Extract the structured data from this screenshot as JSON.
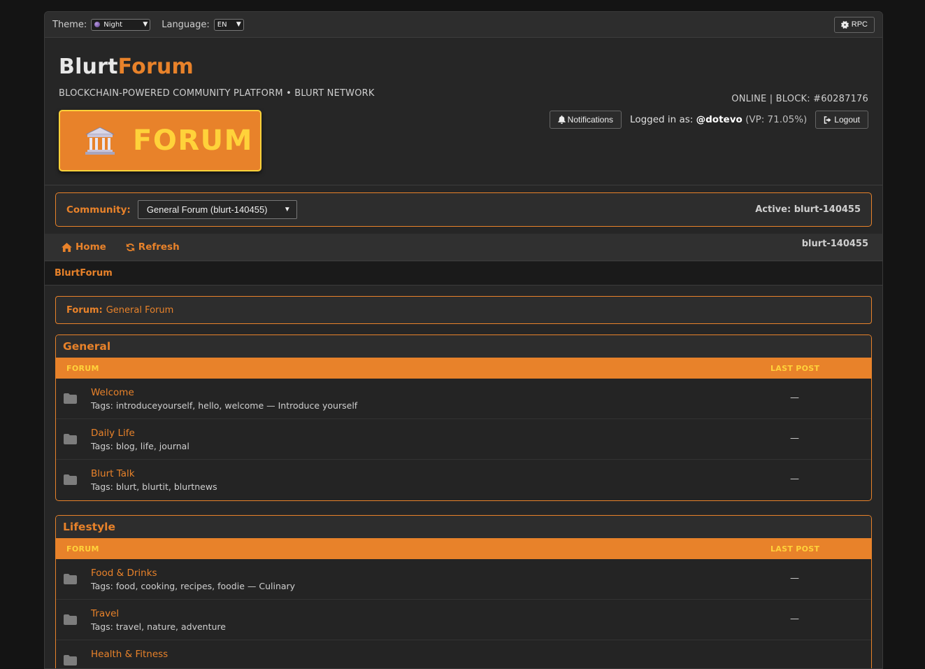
{
  "topbar": {
    "theme_label": "Theme:",
    "theme_value": "Night",
    "language_label": "Language:",
    "language_value": "EN",
    "rpc_label": "RPC"
  },
  "header": {
    "logo_part1": "Blurt",
    "logo_part2": "Forum",
    "tagline": "BLOCKCHAIN-POWERED COMMUNITY PLATFORM • BLURT NETWORK",
    "banner_text": "FORUM",
    "status": "ONLINE | BLOCK: #60287176",
    "notifications_label": "Notifications",
    "logged_in_prefix": "Logged in as:",
    "username": "@dotevo",
    "vp": "(VP: 71.05%)",
    "logout_label": "Logout"
  },
  "community": {
    "label": "Community:",
    "selected": "General Forum (blurt-140455)",
    "active": "Active: blurt-140455"
  },
  "nav": {
    "home": "Home",
    "refresh": "Refresh",
    "current": "blurt-140455"
  },
  "breadcrumb": "BlurtForum",
  "forum_box": {
    "key": "Forum:",
    "value": "General Forum"
  },
  "categories": [
    {
      "title": "General",
      "col_forum": "FORUM",
      "col_last": "LAST POST",
      "forums": [
        {
          "name": "Welcome",
          "tags": "Tags: introduceyourself, hello, welcome — Introduce yourself",
          "last": "—"
        },
        {
          "name": "Daily Life",
          "tags": "Tags: blog, life, journal",
          "last": "—"
        },
        {
          "name": "Blurt Talk",
          "tags": "Tags: blurt, blurtit, blurtnews",
          "last": "—"
        }
      ]
    },
    {
      "title": "Lifestyle",
      "col_forum": "FORUM",
      "col_last": "LAST POST",
      "forums": [
        {
          "name": "Food & Drinks",
          "tags": "Tags: food, cooking, recipes, foodie — Culinary",
          "last": "—"
        },
        {
          "name": "Travel",
          "tags": "Tags: travel, nature, adventure",
          "last": "—"
        },
        {
          "name": "Health & Fitness",
          "tags": "",
          "last": ""
        }
      ]
    }
  ],
  "colors": {
    "accent": "#e8822a",
    "highlight": "#ffd23a",
    "background": "#141414",
    "panel": "#262626"
  }
}
